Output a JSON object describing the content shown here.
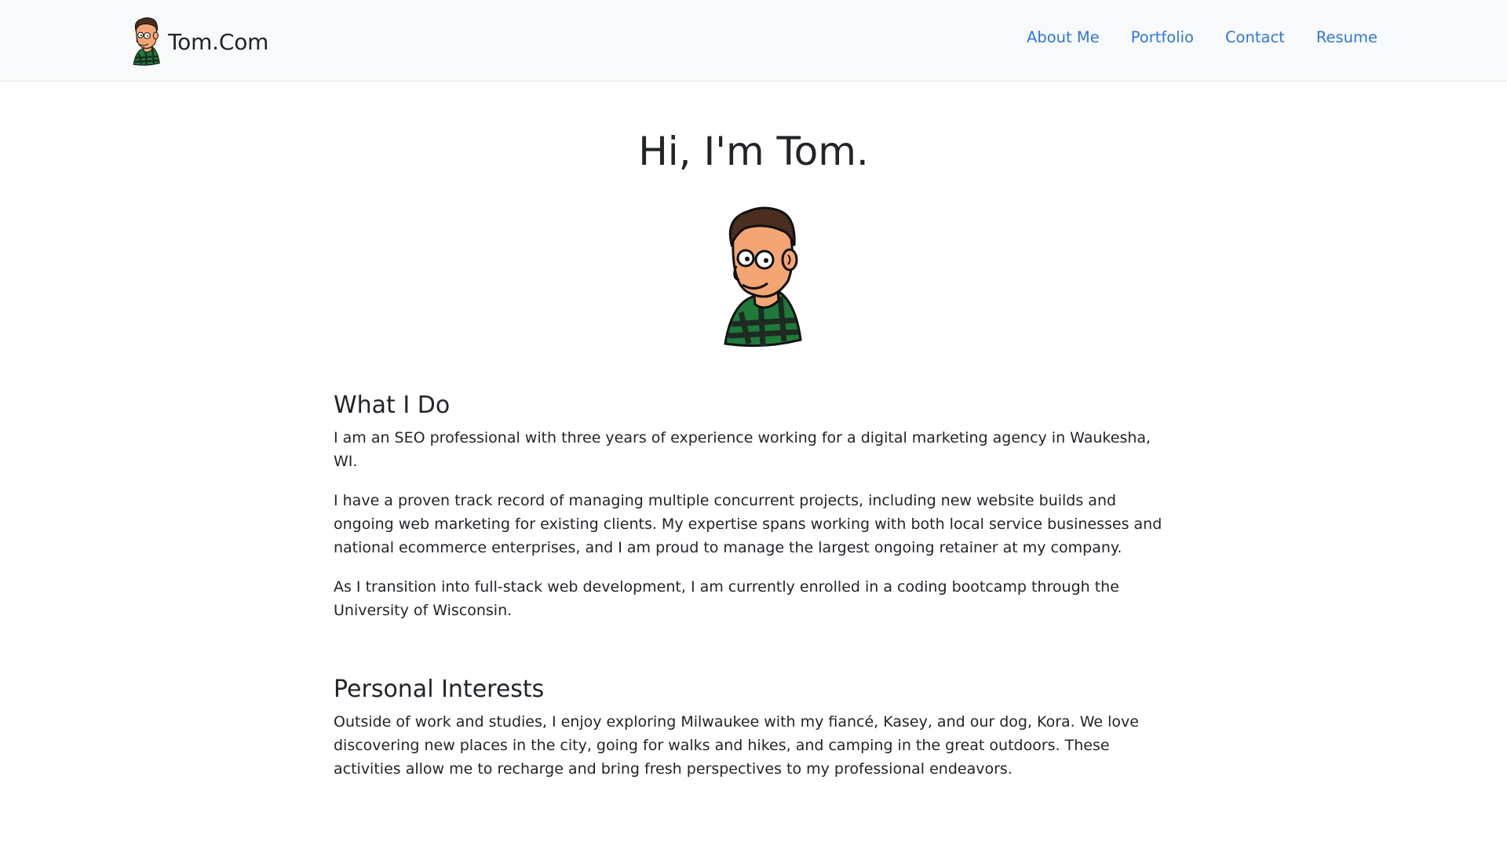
{
  "header": {
    "brand": "Tom.Com",
    "nav": [
      {
        "label": "About Me"
      },
      {
        "label": "Portfolio"
      },
      {
        "label": "Contact"
      },
      {
        "label": "Resume"
      }
    ]
  },
  "hero": {
    "title": "Hi, I'm Tom."
  },
  "sections": [
    {
      "heading": "What I Do",
      "paragraphs": [
        "I am an SEO professional with three years of experience working for a digital marketing agency in Waukesha, WI.",
        "I have a proven track record of managing multiple concurrent projects, including new website builds and ongoing web marketing for existing clients. My expertise spans working with both local service businesses and national ecommerce enterprises, and I am proud to manage the largest ongoing retainer at my company.",
        "As I transition into full-stack web development, I am currently enrolled in a coding bootcamp through the University of Wisconsin."
      ]
    },
    {
      "heading": "Personal Interests",
      "paragraphs": [
        "Outside of work and studies, I enjoy exploring Milwaukee with my fiancé, Kasey, and our dog, Kora. We love discovering new places in the city, going for walks and hikes, and camping in the great outdoors. These activities allow me to recharge and bring fresh perspectives to my professional endeavors."
      ]
    }
  ],
  "colors": {
    "link": "#2f78d6",
    "navbar_bg": "#f8f9fa",
    "text": "#212529",
    "skin": "#f4a574",
    "hair": "#4a2e1f",
    "shirt_green": "#1f7a3a",
    "shirt_dark": "#1d2b22"
  },
  "icons": {
    "brand_logo": "cartoon-avatar-icon",
    "hero_image": "cartoon-portrait-icon"
  }
}
